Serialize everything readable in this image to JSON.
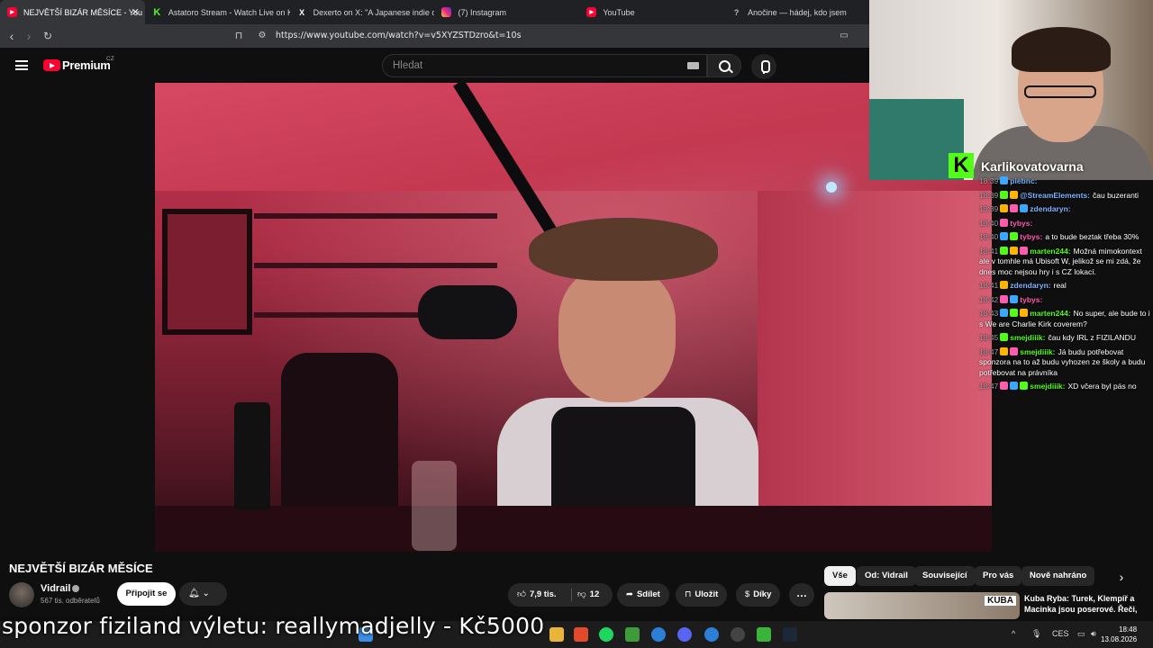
{
  "browser": {
    "tabs": [
      {
        "label": "NEJVĚTŠÍ BIZÁR MĚSÍCE - You",
        "icon": "youtube-icon",
        "active": true
      },
      {
        "label": "Astatoro Stream - Watch Live on Kick",
        "icon": "kick-icon"
      },
      {
        "label": "Dexerto on X: \"A Japanese indie dev",
        "icon": "x-icon"
      },
      {
        "label": "(7) Instagram",
        "icon": "instagram-icon"
      },
      {
        "label": "YouTube",
        "icon": "youtube-icon"
      },
      {
        "label": "Anočine — hádej, kdo jsem",
        "icon": "question-icon"
      }
    ],
    "url": "https://www.youtube.com/watch?v=v5XYZSTDzro&t=10s"
  },
  "youtube": {
    "brand": "Premium",
    "country": "CZ",
    "search_placeholder": "Hledat"
  },
  "video": {
    "title": "NEJVĚTŠÍ BIZÁR MĚSÍCE",
    "channel": "Vidrail",
    "subscribers": "567 tis. odběratelů",
    "join_label": "Připojit se",
    "likes": "7,9 tis.",
    "dislikes": "12",
    "share_label": "Sdílet",
    "save_label": "Uložit",
    "thanks_label": "Díky"
  },
  "chips": [
    "Vše",
    "Od: Vidrail",
    "Související",
    "Pro vás",
    "Nově nahráno"
  ],
  "recommended": {
    "thumb_text": "KUBA",
    "title": "Kuba Ryba: Turek, Klempíř a Macinka jsou poserové. Řeči,"
  },
  "stream": {
    "streamer": "Karlikovatovarna",
    "chat": [
      {
        "time": "18:39",
        "user": "piebnc:",
        "color": "#6fb3ff",
        "text": ""
      },
      {
        "time": "18:39",
        "user": "@StreamElements:",
        "color": "#7fb2ff",
        "text": "čau buzeranti"
      },
      {
        "time": "18:39",
        "user": "zdendaryn:",
        "color": "#7fb2ff",
        "text": ""
      },
      {
        "time": "18:40",
        "user": "tybys:",
        "color": "#ff5cb0",
        "text": ""
      },
      {
        "time": "18:40",
        "user": "tybys:",
        "color": "#ff5cb0",
        "text": "a to bude beztak třeba 30%"
      },
      {
        "time": "18:41",
        "user": "marten244:",
        "color": "#53fc18",
        "text": "Možná mimokontext ale v tomhle má Ubisoft W, jelikož se mi zdá, že dnes moc nejsou hry i s CZ lokací."
      },
      {
        "time": "18:41",
        "user": "zdendaryn:",
        "color": "#7fb2ff",
        "text": "real"
      },
      {
        "time": "18:42",
        "user": "tybys:",
        "color": "#ff5cb0",
        "text": ""
      },
      {
        "time": "18:43",
        "user": "marten244:",
        "color": "#53fc18",
        "text": "No super, ale bude to i s We are Charlie Kirk coverem?"
      },
      {
        "time": "18:45",
        "user": "smejdiiik:",
        "color": "#53fc18",
        "text": "čau kdy IRL z FIZILANDU"
      },
      {
        "time": "18:47",
        "user": "smejdiiik:",
        "color": "#53fc18",
        "text": "Já budu potřebovat sponzora na to až budu vyhozen ze školy a budu potřebovat na právníka"
      },
      {
        "time": "18:47",
        "user": "smejdiiik:",
        "color": "#53fc18",
        "text": "XD včera byl pás no"
      }
    ],
    "sponsor_text": "sponzor fiziland výletu: reallymadjelly - Kč5000"
  },
  "taskbar": {
    "language": "CES",
    "time": "18:48",
    "date": "13.08.2026"
  }
}
